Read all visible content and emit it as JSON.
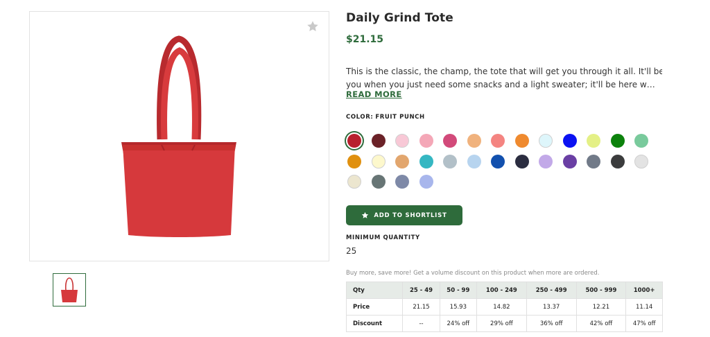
{
  "product": {
    "title": "Daily Grind Tote",
    "price": "$21.15",
    "description_line1": "This is the classic, the champ, the tote that will get you through it all. It'll be here for",
    "description_line2": "you when you just need some snacks and a light sweater; it'll be here when you hav...",
    "read_more": "READ MORE"
  },
  "color": {
    "label": "COLOR:",
    "selected_name": "FRUIT PUNCH",
    "swatches": [
      "#b8202e",
      "#6b2228",
      "#f8c8d6",
      "#f4a7b7",
      "#d24a7a",
      "#f0b27d",
      "#f48481",
      "#ef8a2f",
      "#def6fb",
      "#0b12f2",
      "#e4f086",
      "#0c820c",
      "#79ca9c",
      "#e0900f",
      "#fdf8cc",
      "#e2a66e",
      "#35b7c2",
      "#b2c0c8",
      "#b7d4ef",
      "#1250ae",
      "#2b2d40",
      "#c2a9e8",
      "#6a3fa4",
      "#717a88",
      "#3b3c3d",
      "#e3e3e3",
      "#ece6cf",
      "#677575",
      "#7e89a7",
      "#a8b6ec"
    ],
    "selected_index": 0
  },
  "actions": {
    "shortlist_label": "ADD TO SHORTLIST"
  },
  "minimum_quantity": {
    "label": "MINIMUM QUANTITY",
    "value": "25"
  },
  "volume_note": "Buy more, save more! Get a volume discount on this product when more are ordered.",
  "pricing_table": {
    "headers": [
      "Qty",
      "25 - 49",
      "50 - 99",
      "100 - 249",
      "250 - 499",
      "500 - 999",
      "1000+"
    ],
    "rows": [
      [
        "Price",
        "21.15",
        "15.93",
        "14.82",
        "13.37",
        "12.21",
        "11.14"
      ],
      [
        "Discount",
        "--",
        "24% off",
        "29% off",
        "36% off",
        "42% off",
        "47% off"
      ]
    ]
  },
  "icons": {
    "favorite": "star-icon",
    "shortlist": "star-icon"
  },
  "colors": {
    "accent": "#2e6b3b",
    "bag": "#d6393c"
  }
}
